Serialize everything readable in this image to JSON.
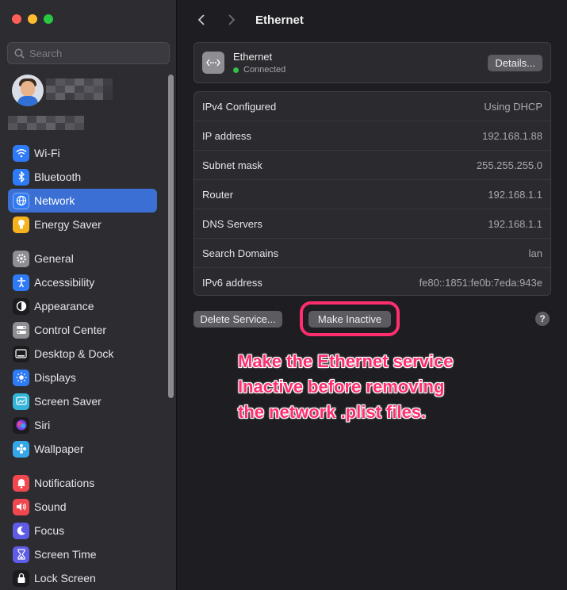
{
  "window": {
    "traffic_lights": {
      "close": "#fe5f57",
      "minimize": "#febc2e",
      "zoom": "#28c840"
    }
  },
  "sidebar": {
    "search_placeholder": "Search",
    "groups": [
      [
        {
          "label": "Wi-Fi",
          "icon": "wifi-icon",
          "color": "#2f7bf5"
        },
        {
          "label": "Bluetooth",
          "icon": "bluetooth-icon",
          "color": "#2f7bf5"
        },
        {
          "label": "Network",
          "icon": "globe-icon",
          "color": "#2f7bf5",
          "selected": true
        },
        {
          "label": "Energy Saver",
          "icon": "bulb-icon",
          "color": "#f5b21e"
        }
      ],
      [
        {
          "label": "General",
          "icon": "gear-icon",
          "color": "#8e8e93"
        },
        {
          "label": "Accessibility",
          "icon": "accessibility-icon",
          "color": "#2f7bf5"
        },
        {
          "label": "Appearance",
          "icon": "appearance-icon",
          "color": "#1c1c1e"
        },
        {
          "label": "Control Center",
          "icon": "control-center-icon",
          "color": "#8e8e93"
        },
        {
          "label": "Desktop & Dock",
          "icon": "dock-icon",
          "color": "#1c1c1e"
        },
        {
          "label": "Displays",
          "icon": "sun-icon",
          "color": "#2f7bf5"
        },
        {
          "label": "Screen Saver",
          "icon": "screen-saver-icon",
          "color": "#35b4d9"
        },
        {
          "label": "Siri",
          "icon": "siri-icon",
          "color": "#7b3fe4"
        },
        {
          "label": "Wallpaper",
          "icon": "wallpaper-icon",
          "color": "#35a6e8"
        }
      ],
      [
        {
          "label": "Notifications",
          "icon": "bell-icon",
          "color": "#f0484e"
        },
        {
          "label": "Sound",
          "icon": "speaker-icon",
          "color": "#f0484e"
        },
        {
          "label": "Focus",
          "icon": "moon-icon",
          "color": "#5e5ce6"
        },
        {
          "label": "Screen Time",
          "icon": "hourglass-icon",
          "color": "#5e5ce6"
        },
        {
          "label": "Lock Screen",
          "icon": "lock-icon",
          "color": "#1c1c1e"
        }
      ]
    ]
  },
  "main": {
    "title": "Ethernet",
    "service": {
      "name": "Ethernet",
      "status": "Connected",
      "details_label": "Details..."
    },
    "info_rows": [
      {
        "key": "IPv4 Configured",
        "value": "Using DHCP"
      },
      {
        "key": "IP address",
        "value": "192.168.1.88"
      },
      {
        "key": "Subnet mask",
        "value": "255.255.255.0"
      },
      {
        "key": "Router",
        "value": "192.168.1.1"
      },
      {
        "key": "DNS Servers",
        "value": "192.168.1.1"
      },
      {
        "key": "Search Domains",
        "value": "lan"
      },
      {
        "key": "IPv6 address",
        "value": "fe80::1851:fe0b:7eda:943e"
      }
    ],
    "delete_label": "Delete Service...",
    "make_inactive_label": "Make Inactive",
    "help_label": "?",
    "annotation_lines": [
      "Make the Ethernet service",
      "Inactive before removing",
      "the network .plist files."
    ],
    "annotation_color": "#ff2e6e"
  }
}
